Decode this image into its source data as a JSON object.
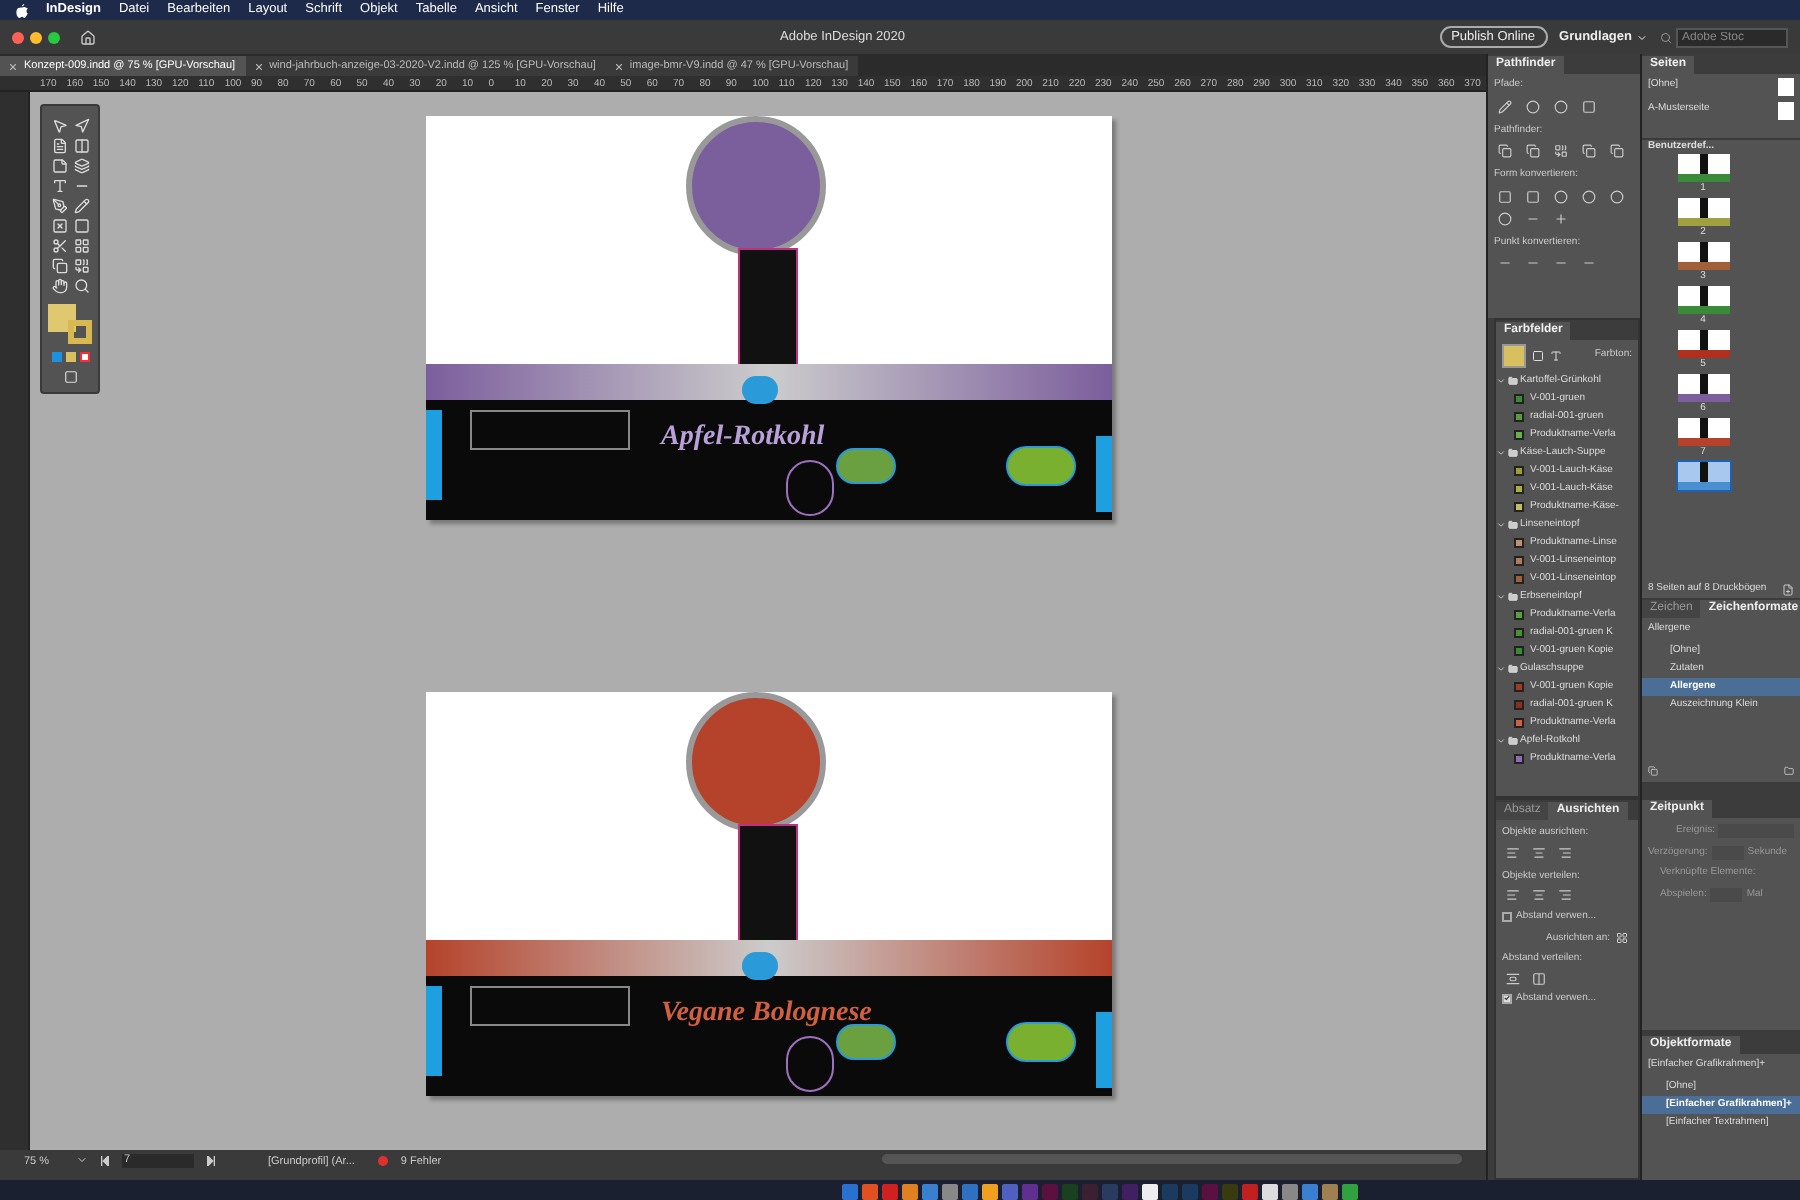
{
  "menu_bar": {
    "app": "InDesign",
    "items": [
      "Datei",
      "Bearbeiten",
      "Layout",
      "Schrift",
      "Objekt",
      "Tabelle",
      "Ansicht",
      "Fenster",
      "Hilfe"
    ]
  },
  "title_bar": {
    "title": "Adobe InDesign 2020",
    "publish_button": "Publish Online",
    "workspace": "Grundlagen",
    "search": {
      "placeholder": "Adobe Stoc"
    }
  },
  "document_tabs": [
    {
      "label": "Konzept-009.indd @ 75 % [GPU-Vorschau]",
      "selected": true
    },
    {
      "label": "wind-jahrbuch-anzeige-03-2020-V2.indd @ 125 % [GPU-Vorschau]",
      "selected": false
    },
    {
      "label": "image-bmr-V9.indd @ 47 % [GPU-Vorschau]",
      "selected": false
    }
  ],
  "ruler": [
    "170",
    "160",
    "150",
    "140",
    "130",
    "120",
    "110",
    "100",
    "90",
    "80",
    "70",
    "60",
    "50",
    "40",
    "30",
    "20",
    "10",
    "0",
    "10",
    "20",
    "30",
    "40",
    "50",
    "60",
    "70",
    "80",
    "90",
    "100",
    "110",
    "120",
    "130",
    "140",
    "150",
    "160",
    "170",
    "180",
    "190",
    "200",
    "210",
    "220",
    "230",
    "240",
    "250",
    "260",
    "270",
    "280",
    "290",
    "300",
    "310",
    "320",
    "330",
    "340",
    "350",
    "360",
    "370"
  ],
  "pages": [
    {
      "title": "Apfel-Rotkohl",
      "color": "#7b5e9c"
    },
    {
      "title": "Vegane Bolognese",
      "color": "#b5432b"
    }
  ],
  "status_bar": {
    "zoom": "75 %",
    "page": "7",
    "profile": "[Grundprofil] (Ar...",
    "errors": "9 Fehler"
  },
  "pathfinder": {
    "title": "Pathfinder",
    "sections": [
      "Pfade:",
      "Pathfinder:",
      "Form konvertieren:",
      "Punkt konvertieren:"
    ]
  },
  "swatches": {
    "title": "Farbfelder",
    "tint_label": "Farbton:",
    "groups": [
      {
        "name": "Kartoffel-Grünkohl",
        "expanded": true,
        "children": [
          {
            "name": "V-001-gruen",
            "color": "#3a8a3a"
          },
          {
            "name": "radial-001-gruen",
            "color": "#5a9a40"
          },
          {
            "name": "Produktname-Verla",
            "color": "#6ab04a"
          }
        ]
      },
      {
        "name": "Käse-Lauch-Suppe",
        "expanded": true,
        "children": [
          {
            "name": "V-001-Lauch-Käse",
            "color": "#9aa030"
          },
          {
            "name": "V-001-Lauch-Käse",
            "color": "#a8b040"
          },
          {
            "name": "Produktname-Käse-",
            "color": "#c0c060"
          }
        ]
      },
      {
        "name": "Linseneintopf",
        "expanded": true,
        "children": [
          {
            "name": "Produktname-Linse",
            "color": "#c09070"
          },
          {
            "name": "V-001-Linseneintop",
            "color": "#b07a60"
          },
          {
            "name": "V-001-Linseneintop",
            "color": "#a06040"
          }
        ]
      },
      {
        "name": "Erbseneintopf",
        "expanded": true,
        "children": [
          {
            "name": "Produktname-Verla",
            "color": "#5aa040"
          },
          {
            "name": "radial-001-gruen K",
            "color": "#4a9030"
          },
          {
            "name": "V-001-gruen Kopie",
            "color": "#3a8a30"
          }
        ]
      },
      {
        "name": "Gulaschsuppe",
        "expanded": true,
        "children": [
          {
            "name": "V-001-gruen Kopie",
            "color": "#a03a20"
          },
          {
            "name": "radial-001-gruen K",
            "color": "#8a3020"
          },
          {
            "name": "Produktname-Verla",
            "color": "#d06040"
          }
        ]
      },
      {
        "name": "Apfel-Rotkohl",
        "expanded": true,
        "children": [
          {
            "name": "Produktname-Verla",
            "color": "#8a70b0"
          }
        ]
      }
    ]
  },
  "align": {
    "tabs": [
      {
        "label": "Absatz",
        "selected": false
      },
      {
        "label": "Ausrichten",
        "selected": true
      }
    ],
    "align_label": "Objekte ausrichten:",
    "distribute_label": "Objekte verteilen:",
    "use_spacing_1": {
      "label": "Abstand verwen...",
      "checked": false
    },
    "align_to_label": "Ausrichten an:",
    "spacing_label": "Abstand verteilen:",
    "use_spacing_2": {
      "label": "Abstand verwen...",
      "checked": true
    }
  },
  "pages_panel": {
    "title": "Seiten",
    "masters": [
      "[Ohne]",
      "A-Musterseite"
    ],
    "view": "Benutzerdef...",
    "pages": [
      {
        "number": "1",
        "color": "#3a8a3a",
        "selected": false
      },
      {
        "number": "2",
        "color": "#a0a040",
        "selected": false
      },
      {
        "number": "3",
        "color": "#a0603a",
        "selected": false
      },
      {
        "number": "4",
        "color": "#3a8a3a",
        "selected": false
      },
      {
        "number": "5",
        "color": "#b03020",
        "selected": false
      },
      {
        "number": "6",
        "color": "#7b5e9c",
        "selected": false
      },
      {
        "number": "7",
        "color": "#b5432b",
        "selected": false
      },
      {
        "color": "#4a90d0",
        "selected": true
      }
    ],
    "footer": "8 Seiten auf 8 Druckbögen"
  },
  "character_styles": {
    "tabs": [
      {
        "label": "Zeichen",
        "selected": false
      },
      {
        "label": "Zeichenformate",
        "selected": true
      }
    ],
    "current": "Allergene",
    "items": [
      {
        "label": "[Ohne]",
        "selected": false
      },
      {
        "label": "Zutaten",
        "selected": false
      },
      {
        "label": "Allergene",
        "selected": true
      },
      {
        "label": "Auszeichnung Klein",
        "selected": false
      }
    ]
  },
  "timing": {
    "title": "Zeitpunkt",
    "event_label": "Ereignis:",
    "delay_label": "Verzögerung:",
    "delay_unit": "Sekunde",
    "linked_label": "Verknüpfte Elemente:",
    "play_label": "Abspielen:",
    "play_unit": "Mal"
  },
  "object_styles": {
    "title": "Objektformate",
    "current": "[Einfacher Grafikrahmen]+",
    "items": [
      {
        "label": "[Ohne]",
        "selected": false
      },
      {
        "label": "[Einfacher Grafikrahmen]+",
        "selected": true
      },
      {
        "label": "[Einfacher Textrahmen]",
        "selected": false
      }
    ]
  }
}
